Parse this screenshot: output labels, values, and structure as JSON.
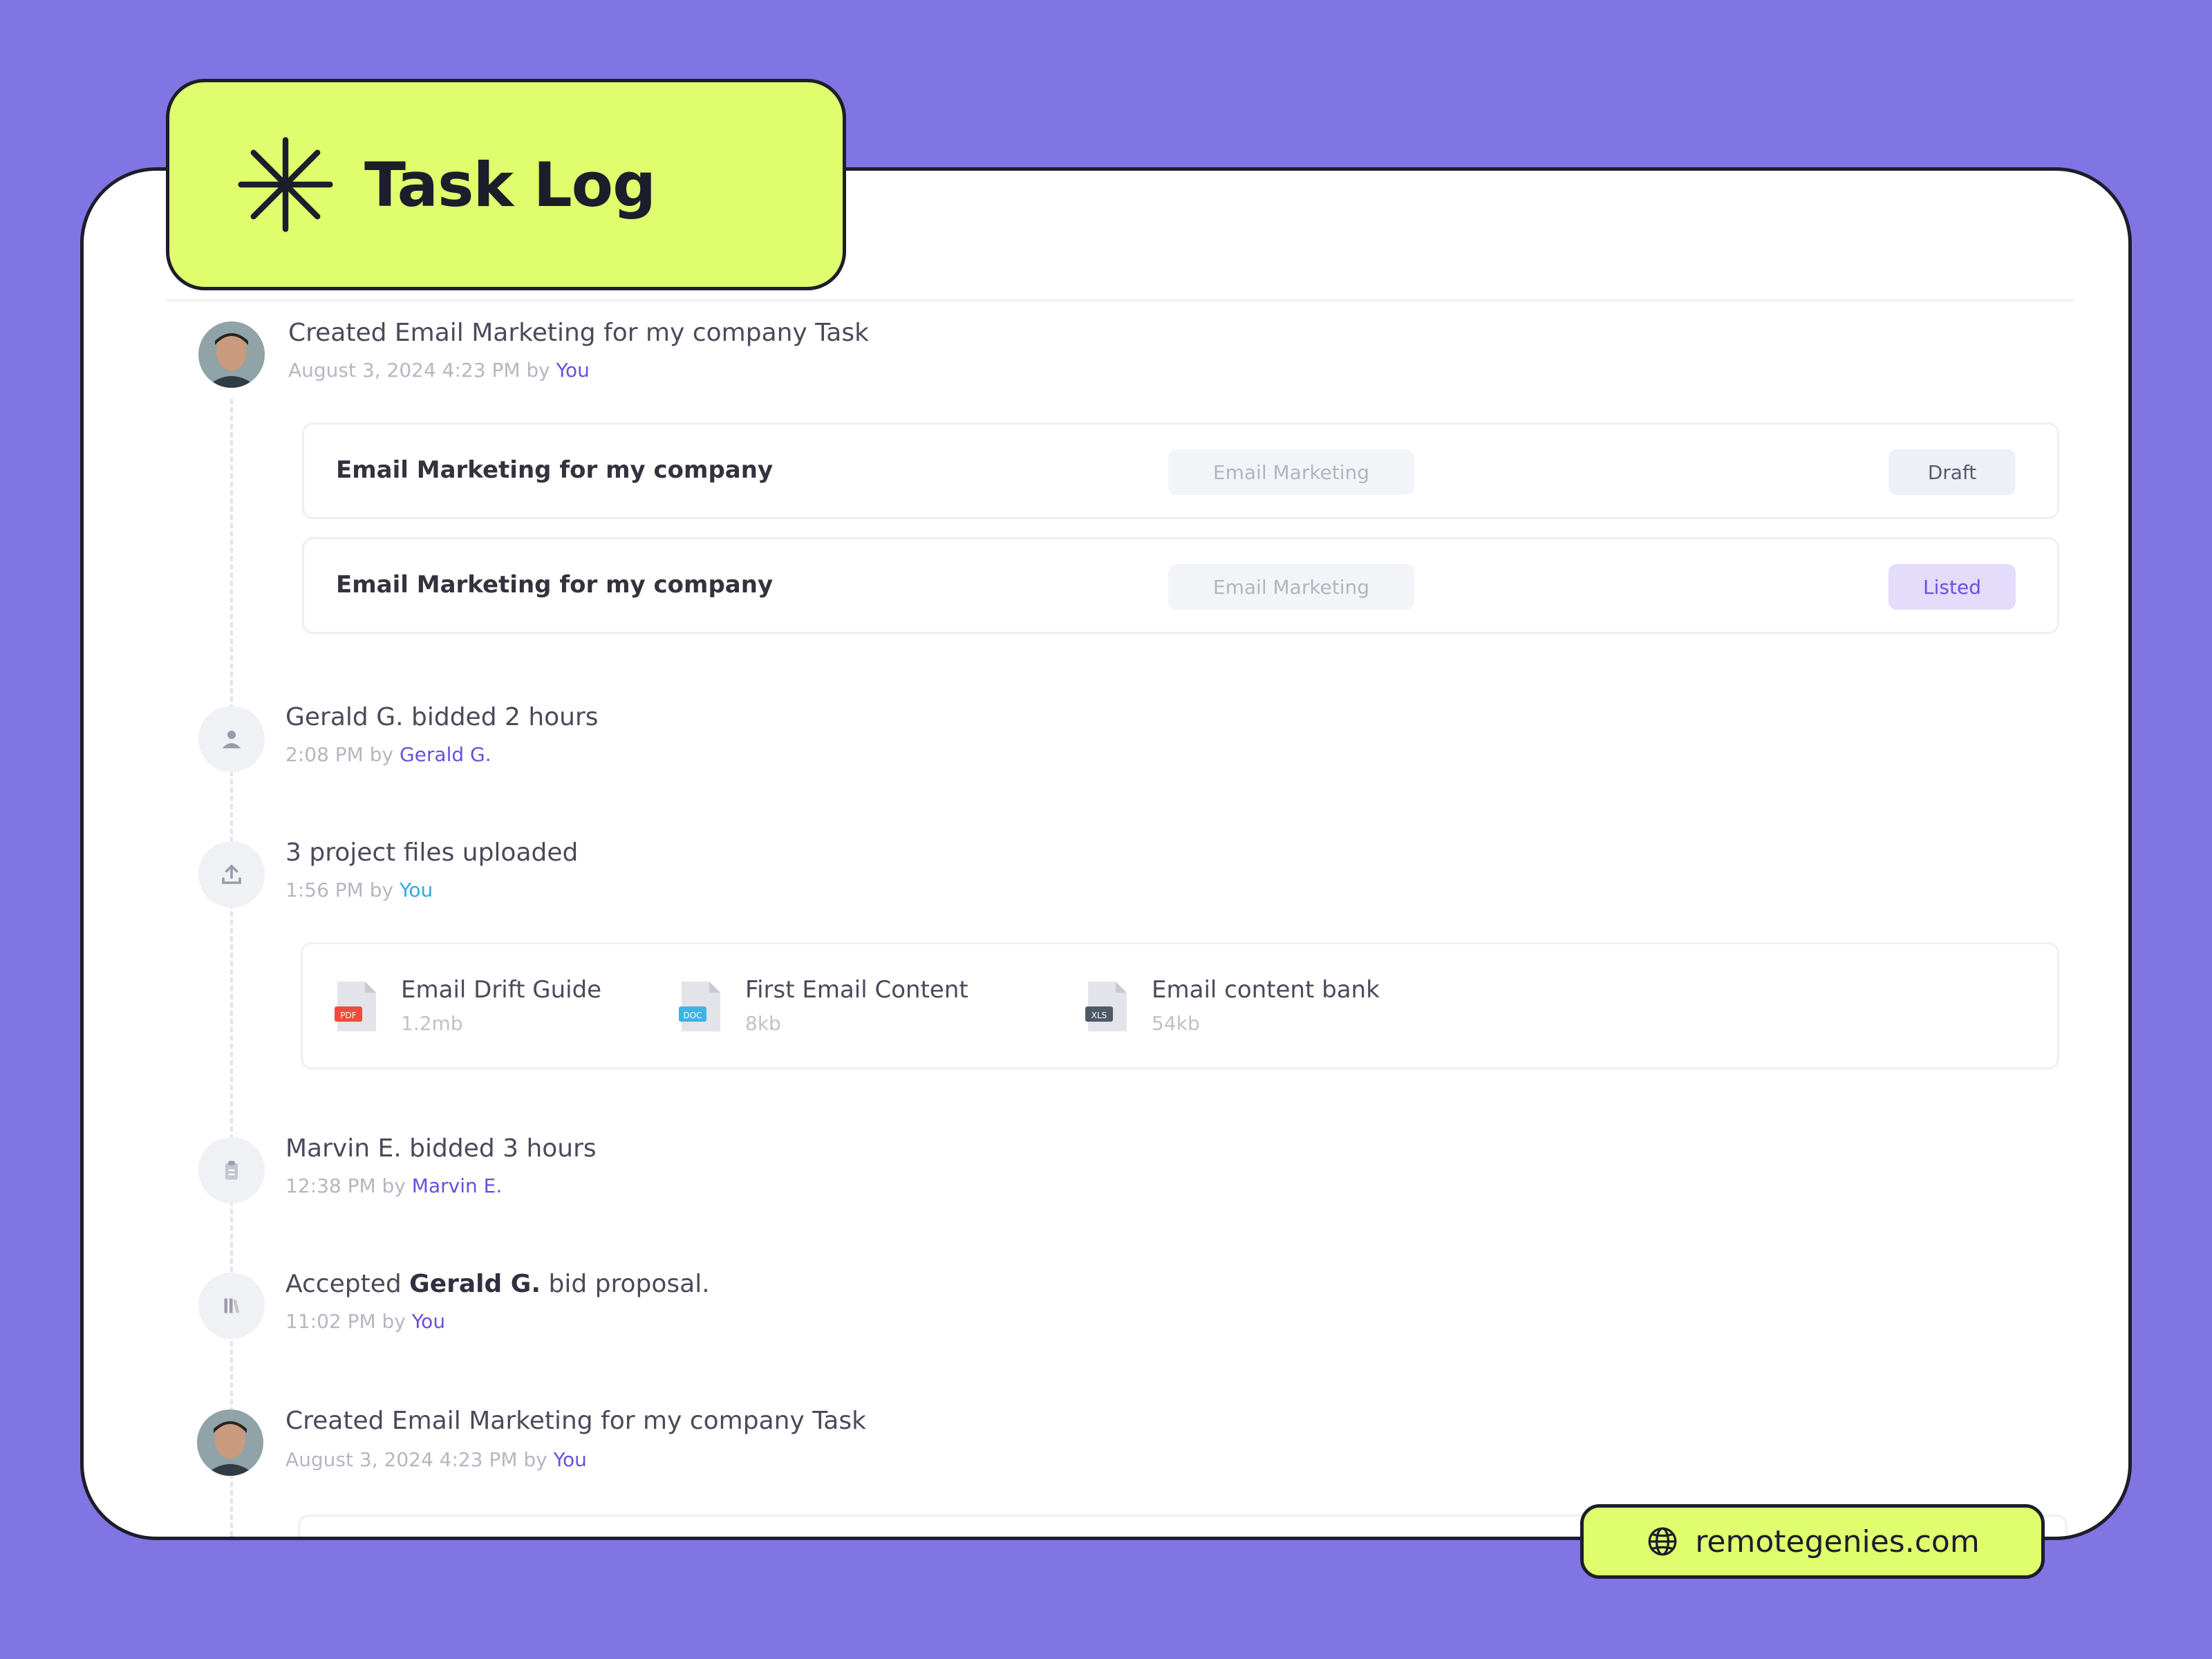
{
  "header": {
    "title": "Task Log"
  },
  "colors": {
    "background": "#8075e2",
    "accent_lime": "#e0fd6e",
    "link_purple": "#6a4ee0",
    "link_cyan": "#2fa8ea"
  },
  "entries": [
    {
      "title": "Created Email Marketing for my company Task",
      "time": "August 3, 2024 4:23 PM",
      "by_prefix": "by",
      "by": "You",
      "icon": "user-avatar",
      "tasks": [
        {
          "name": "Email Marketing for my company",
          "tag": "Email Marketing",
          "status": "Draft"
        },
        {
          "name": "Email Marketing for my company",
          "tag": "Email Marketing",
          "status": "Listed"
        }
      ]
    },
    {
      "title": "Gerald G. bidded 2 hours",
      "time": "2:08 PM",
      "by_prefix": "by",
      "by": "Gerald G.",
      "icon": "user-icon"
    },
    {
      "title": "3 project files uploaded",
      "time": "1:56 PM",
      "by_prefix": "by",
      "by": "You",
      "icon": "upload-icon",
      "files": [
        {
          "name": "Email Drift Guide",
          "size": "1.2mb",
          "type": "PDF",
          "icon": "pdf-file-icon"
        },
        {
          "name": "First Email Content",
          "size": "8kb",
          "type": "DOC",
          "icon": "doc-file-icon"
        },
        {
          "name": "Email content bank",
          "size": "54kb",
          "type": "XLS",
          "icon": "xls-file-icon"
        }
      ]
    },
    {
      "title": "Marvin E. bidded 3 hours",
      "time": "12:38 PM",
      "by_prefix": "by",
      "by": "Marvin E.",
      "icon": "clipboard-icon"
    },
    {
      "title_prefix": "Accepted",
      "title_bold": "Gerald G.",
      "title_suffix": "bid proposal.",
      "time": "11:02 PM",
      "by_prefix": "by",
      "by": "You",
      "icon": "library-icon"
    },
    {
      "title": "Created Email Marketing for my company Task",
      "time": "August 3, 2024 4:23 PM",
      "by_prefix": "by",
      "by": "You",
      "icon": "user-avatar"
    }
  ],
  "footer": {
    "site": "remotegenies.com",
    "icon": "globe-icon"
  }
}
